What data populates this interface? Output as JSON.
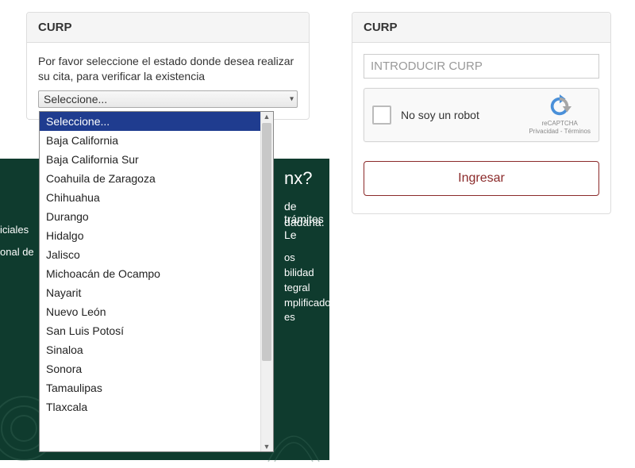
{
  "left_panel": {
    "title": "CURP",
    "instruction": "Por favor seleccione el estado donde desea realizar su cita, para verificar la existencia",
    "select_display": "Seleccione...",
    "options": [
      "Seleccione...",
      "Baja California",
      "Baja California Sur",
      "Coahuila de Zaragoza",
      "Chihuahua",
      "Durango",
      "Hidalgo",
      "Jalisco",
      "Michoacán de Ocampo",
      "Nayarit",
      "Nuevo León",
      "San Luis Potosí",
      "Sinaloa",
      "Sonora",
      "Tamaulipas",
      "Tlaxcala"
    ],
    "selected_index": 0
  },
  "right_panel": {
    "title": "CURP",
    "placeholder": "INTRODUCIR CURP",
    "recaptcha_label": "No soy un robot",
    "recaptcha_brand": "reCAPTCHA",
    "recaptcha_terms": "Privacidad - Términos",
    "submit_label": "Ingresar"
  },
  "background": {
    "heading_fragment": "nx?",
    "line1": "de trámites",
    "line2": "dadana. Le",
    "left1": "iciales",
    "left2": "onal de",
    "list": [
      "os",
      "bilidad",
      "tegral",
      "mplificado",
      "es"
    ]
  }
}
